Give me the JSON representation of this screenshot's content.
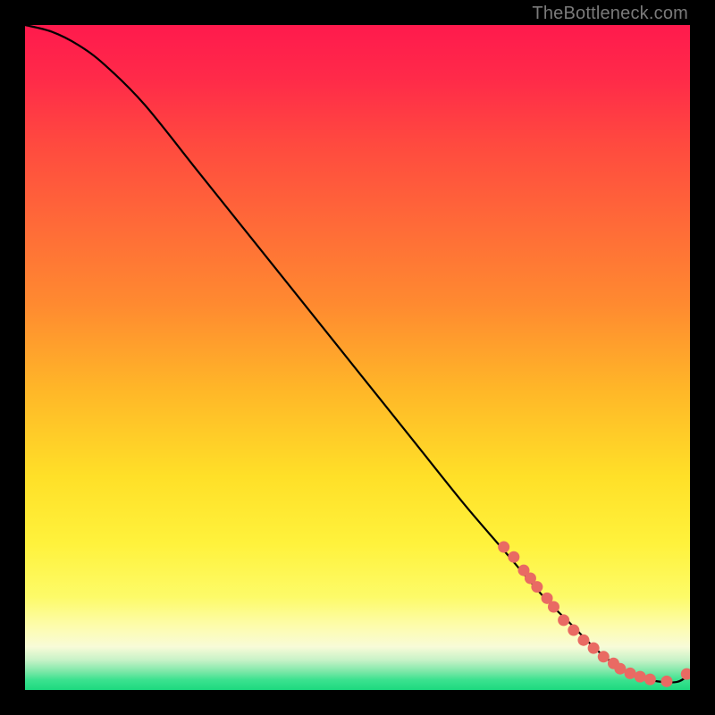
{
  "attribution": "TheBottleneck.com",
  "colors": {
    "gradient_stops": [
      {
        "offset": 0.0,
        "color": "#ff1a4d"
      },
      {
        "offset": 0.08,
        "color": "#ff2a49"
      },
      {
        "offset": 0.18,
        "color": "#ff4a3f"
      },
      {
        "offset": 0.3,
        "color": "#ff6a38"
      },
      {
        "offset": 0.42,
        "color": "#ff8a30"
      },
      {
        "offset": 0.55,
        "color": "#ffb728"
      },
      {
        "offset": 0.68,
        "color": "#ffe028"
      },
      {
        "offset": 0.78,
        "color": "#fff23c"
      },
      {
        "offset": 0.86,
        "color": "#fdfb68"
      },
      {
        "offset": 0.905,
        "color": "#fdfcae"
      },
      {
        "offset": 0.935,
        "color": "#f8fbd8"
      },
      {
        "offset": 0.955,
        "color": "#c7f2c7"
      },
      {
        "offset": 0.972,
        "color": "#7de8a8"
      },
      {
        "offset": 0.985,
        "color": "#3be28f"
      },
      {
        "offset": 1.0,
        "color": "#1dd97f"
      }
    ],
    "curve": "#000000",
    "marker": "#e96a63",
    "bg": "#000000"
  },
  "chart_data": {
    "type": "line",
    "title": "",
    "xlabel": "",
    "ylabel": "",
    "xlim": [
      0,
      100
    ],
    "ylim": [
      0,
      100
    ],
    "series": [
      {
        "name": "bottleneck-curve",
        "x": [
          0,
          4,
          8,
          12,
          18,
          26,
          34,
          42,
          50,
          58,
          66,
          72,
          78,
          82,
          86,
          90,
          94,
          98,
          100
        ],
        "y": [
          100,
          99,
          97,
          94,
          88,
          78,
          68,
          58,
          48,
          38,
          28,
          21,
          14,
          10,
          6,
          3,
          1.5,
          1.2,
          2.5
        ]
      }
    ],
    "markers": {
      "name": "highlight-points",
      "x": [
        72,
        73.5,
        75,
        76,
        77,
        78.5,
        79.5,
        81,
        82.5,
        84,
        85.5,
        87,
        88.5,
        89.5,
        91,
        92.5,
        94,
        96.5,
        99.5
      ],
      "y": [
        21.5,
        20,
        18,
        16.8,
        15.5,
        13.8,
        12.5,
        10.5,
        9,
        7.5,
        6.3,
        5,
        4,
        3.2,
        2.5,
        2,
        1.6,
        1.3,
        2.4
      ]
    }
  }
}
